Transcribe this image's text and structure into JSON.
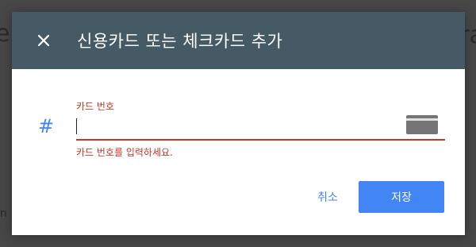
{
  "background": {
    "fragment_left": "e",
    "fragment_right": "ra",
    "fragment_small": "in"
  },
  "dialog": {
    "title": "신용카드 또는 체크카드 추가",
    "close_icon": "close-icon",
    "header_color": "#455a64"
  },
  "card_field": {
    "label": "카드 번호",
    "value": "",
    "placeholder": "",
    "error": "카드 번호를 입력하세요.",
    "prefix_icon": "#",
    "suffix_icon": "credit-card-icon",
    "error_color": "#c0392b"
  },
  "actions": {
    "cancel_label": "취소",
    "save_label": "저장",
    "accent": "#4285f4"
  }
}
